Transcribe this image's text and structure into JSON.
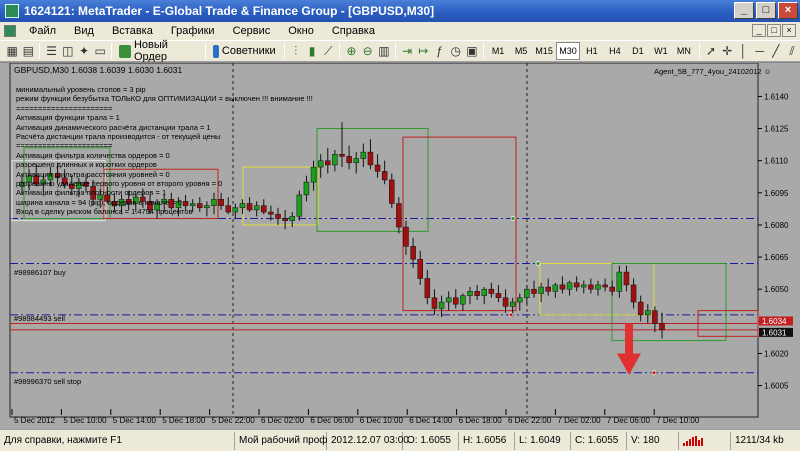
{
  "window": {
    "title": "1624121: MetaTrader - E-Global Trade & Finance Group - [GBPUSD,M30]",
    "buttons": [
      "_",
      "□",
      "×"
    ]
  },
  "menu": {
    "items": [
      "Файл",
      "Вид",
      "Вставка",
      "Графики",
      "Сервис",
      "Окно",
      "Справка"
    ],
    "mdi_buttons": [
      "_",
      "□",
      "×"
    ]
  },
  "toolbar": {
    "new_order": "Новый Ордер",
    "advisors": "Советники",
    "timeframes": [
      "M1",
      "M5",
      "M15",
      "M30",
      "H1",
      "H4",
      "D1",
      "W1",
      "MN"
    ],
    "active_timeframe": "M30"
  },
  "chart": {
    "header": "GBPUSD,M30  1.6038 1.6039 1.6030 1.6031",
    "expert": "Agent_5B_777_4you_24102012 ☺",
    "info_lines": [
      "минимальный уровень стопов =  3  pip",
      "режим функции безубытка ТОЛЬКО для ОПТИМИЗАЦИИ =  выключен  !!! внимание !!!",
      "======================",
      "Активация функции трала =  1",
      "Активация динамического расчёта дистанции трала =  1",
      "Расчёта дистанции трала производится - от текущей цены",
      "======================",
      "   Активация фильтра количества ордеров =  0",
      "разрешено длинных и коротких ордеров",
      "    Активация фильтра расстояния уровней =  0",
      "разрешено удаление первого уровня от второго уровня =  0",
      "    Активация фильтра плотности ордеров =  1",
      "ширина канала =  94 (pip), ордеров в канале =  0",
      "Вход в сделку риском баланса =  1.4794 процентов"
    ],
    "order_labels": [
      "#98986107 buy",
      "#98984493 sell",
      "#98996370 sell stop"
    ],
    "price_ticks": [
      "1.6140",
      "1.6125",
      "1.6110",
      "1.6095",
      "1.6080",
      "1.6065",
      "1.6050",
      "1.6035",
      "1.6020",
      "1.6005"
    ],
    "price_markers": [
      "1.6034",
      "1.6031"
    ],
    "time_ticks": [
      "5 Dec 2012",
      "5 Dec 10:00",
      "5 Dec 14:00",
      "5 Dec 18:00",
      "5 Dec 22:00",
      "6 Dec 02:00",
      "6 Dec 06:00",
      "6 Dec 10:00",
      "6 Dec 14:00",
      "6 Dec 18:00",
      "6 Dec 22:00",
      "7 Dec 02:00",
      "7 Dec 06:00",
      "7 Dec 10:00"
    ]
  },
  "chart_data": {
    "type": "candlestick",
    "symbol": "GBPUSD",
    "timeframe": "M30",
    "ylim": [
      1.5995,
      1.615
    ],
    "background": "#ffffff",
    "up_color": "#1e9e1e",
    "down_color": "#a01010",
    "candles": [
      [
        1.6098,
        1.6104,
        1.6094,
        1.61
      ],
      [
        1.61,
        1.6106,
        1.6096,
        1.6103
      ],
      [
        1.6103,
        1.6108,
        1.6098,
        1.6099
      ],
      [
        1.6099,
        1.6104,
        1.6095,
        1.6101
      ],
      [
        1.6101,
        1.6107,
        1.6098,
        1.6104
      ],
      [
        1.6104,
        1.6109,
        1.61,
        1.6102
      ],
      [
        1.6102,
        1.6106,
        1.6097,
        1.6099
      ],
      [
        1.6099,
        1.6103,
        1.6094,
        1.6097
      ],
      [
        1.6097,
        1.6102,
        1.6093,
        1.61
      ],
      [
        1.61,
        1.6104,
        1.6095,
        1.6098
      ],
      [
        1.6098,
        1.6101,
        1.6089,
        1.6092
      ],
      [
        1.6092,
        1.6097,
        1.6088,
        1.6094
      ],
      [
        1.6094,
        1.6098,
        1.609,
        1.6091
      ],
      [
        1.6091,
        1.6095,
        1.6086,
        1.6089
      ],
      [
        1.6089,
        1.6094,
        1.6085,
        1.6092
      ],
      [
        1.6092,
        1.6096,
        1.6087,
        1.609
      ],
      [
        1.609,
        1.6095,
        1.6086,
        1.6093
      ],
      [
        1.6093,
        1.6097,
        1.6088,
        1.6091
      ],
      [
        1.6091,
        1.6094,
        1.6085,
        1.6087
      ],
      [
        1.6087,
        1.6092,
        1.6083,
        1.609
      ],
      [
        1.609,
        1.6094,
        1.6086,
        1.6092
      ],
      [
        1.6092,
        1.6095,
        1.6087,
        1.6088
      ],
      [
        1.6088,
        1.6093,
        1.6084,
        1.6091
      ],
      [
        1.6091,
        1.6094,
        1.6087,
        1.6089
      ],
      [
        1.6089,
        1.6092,
        1.6086,
        1.609
      ],
      [
        1.609,
        1.6093,
        1.6086,
        1.6088
      ],
      [
        1.6088,
        1.6091,
        1.6084,
        1.6089
      ],
      [
        1.6089,
        1.6095,
        1.6085,
        1.6092
      ],
      [
        1.6092,
        1.6095,
        1.6087,
        1.6089
      ],
      [
        1.6089,
        1.6093,
        1.6085,
        1.6086
      ],
      [
        1.6086,
        1.609,
        1.6083,
        1.6088
      ],
      [
        1.6088,
        1.6092,
        1.6085,
        1.609
      ],
      [
        1.609,
        1.6093,
        1.6086,
        1.6087
      ],
      [
        1.6087,
        1.6091,
        1.6084,
        1.6089
      ],
      [
        1.6089,
        1.6092,
        1.6085,
        1.6086
      ],
      [
        1.6086,
        1.6089,
        1.6082,
        1.6085
      ],
      [
        1.6085,
        1.6088,
        1.608,
        1.6083
      ],
      [
        1.6083,
        1.6087,
        1.6078,
        1.6082
      ],
      [
        1.6082,
        1.6086,
        1.6079,
        1.6084
      ],
      [
        1.6084,
        1.6096,
        1.6082,
        1.6094
      ],
      [
        1.6094,
        1.6103,
        1.6091,
        1.61
      ],
      [
        1.61,
        1.611,
        1.6096,
        1.6107
      ],
      [
        1.6107,
        1.6113,
        1.6102,
        1.611
      ],
      [
        1.611,
        1.6116,
        1.6104,
        1.6108
      ],
      [
        1.6108,
        1.6115,
        1.6105,
        1.6113
      ],
      [
        1.6113,
        1.6128,
        1.6107,
        1.6112
      ],
      [
        1.6112,
        1.6117,
        1.6106,
        1.6109
      ],
      [
        1.6109,
        1.6114,
        1.6104,
        1.6111
      ],
      [
        1.6111,
        1.6118,
        1.6107,
        1.6114
      ],
      [
        1.6114,
        1.612,
        1.6106,
        1.6108
      ],
      [
        1.6108,
        1.6113,
        1.6102,
        1.6105
      ],
      [
        1.6105,
        1.611,
        1.6099,
        1.6101
      ],
      [
        1.6101,
        1.6104,
        1.6088,
        1.609
      ],
      [
        1.609,
        1.6093,
        1.6076,
        1.6079
      ],
      [
        1.6079,
        1.6082,
        1.6066,
        1.607
      ],
      [
        1.607,
        1.6074,
        1.606,
        1.6064
      ],
      [
        1.6064,
        1.6068,
        1.6052,
        1.6055
      ],
      [
        1.6055,
        1.6059,
        1.6043,
        1.6046
      ],
      [
        1.6046,
        1.605,
        1.6038,
        1.6041
      ],
      [
        1.6041,
        1.6047,
        1.6037,
        1.6044
      ],
      [
        1.6044,
        1.6049,
        1.604,
        1.6046
      ],
      [
        1.6046,
        1.605,
        1.6041,
        1.6043
      ],
      [
        1.6043,
        1.6048,
        1.604,
        1.6047
      ],
      [
        1.6047,
        1.6051,
        1.6043,
        1.6049
      ],
      [
        1.6049,
        1.6052,
        1.6045,
        1.6047
      ],
      [
        1.6047,
        1.6051,
        1.6043,
        1.605
      ],
      [
        1.605,
        1.6053,
        1.6046,
        1.6048
      ],
      [
        1.6048,
        1.6052,
        1.6044,
        1.6046
      ],
      [
        1.6046,
        1.605,
        1.6039,
        1.6042
      ],
      [
        1.6042,
        1.6046,
        1.6037,
        1.6044
      ],
      [
        1.6044,
        1.6048,
        1.604,
        1.6046
      ],
      [
        1.6046,
        1.6052,
        1.6043,
        1.605
      ],
      [
        1.605,
        1.6054,
        1.6046,
        1.6048
      ],
      [
        1.6048,
        1.6053,
        1.6044,
        1.6051
      ],
      [
        1.6051,
        1.6055,
        1.6047,
        1.6049
      ],
      [
        1.6049,
        1.6053,
        1.6046,
        1.6052
      ],
      [
        1.6052,
        1.6056,
        1.6048,
        1.605
      ],
      [
        1.605,
        1.6054,
        1.6047,
        1.6053
      ],
      [
        1.6053,
        1.6056,
        1.6049,
        1.6051
      ],
      [
        1.6051,
        1.6054,
        1.6048,
        1.6052
      ],
      [
        1.6052,
        1.6055,
        1.6048,
        1.605
      ],
      [
        1.605,
        1.6054,
        1.6047,
        1.6052
      ],
      [
        1.6052,
        1.6055,
        1.6049,
        1.6051
      ],
      [
        1.6051,
        1.6054,
        1.6047,
        1.6049
      ],
      [
        1.6049,
        1.6061,
        1.6046,
        1.6058
      ],
      [
        1.6058,
        1.6061,
        1.6049,
        1.6052
      ],
      [
        1.6052,
        1.6055,
        1.6041,
        1.6044
      ],
      [
        1.6044,
        1.6047,
        1.6035,
        1.6038
      ],
      [
        1.6038,
        1.6043,
        1.6034,
        1.604
      ],
      [
        1.604,
        1.6042,
        1.603,
        1.6034
      ],
      [
        1.6034,
        1.6039,
        1.6027,
        1.6031
      ]
    ],
    "lines": [
      {
        "type": "buy",
        "price": 1.6062,
        "color": "#1a1a9e",
        "style": "dash-dot"
      },
      {
        "type": "sell",
        "price": 1.6038,
        "color": "#1a1a9e",
        "style": "dash-dot"
      },
      {
        "type": "sell stop",
        "price": 1.6011,
        "color": "#1a1a9e",
        "style": "dash-dot"
      },
      {
        "type": "order",
        "price": 1.6083,
        "color": "#1a1a9e",
        "style": "dash-dot"
      }
    ]
  },
  "status": {
    "help": "Для справки, нажмите F1",
    "profile": "Мой рабочий проф",
    "datetime": "2012.12.07 03:00",
    "open": "O: 1.6055",
    "high": "H: 1.6056",
    "low": "L: 1.6049",
    "close": "C: 1.6055",
    "volume": "V: 180",
    "traffic": "1211/34 kb"
  }
}
